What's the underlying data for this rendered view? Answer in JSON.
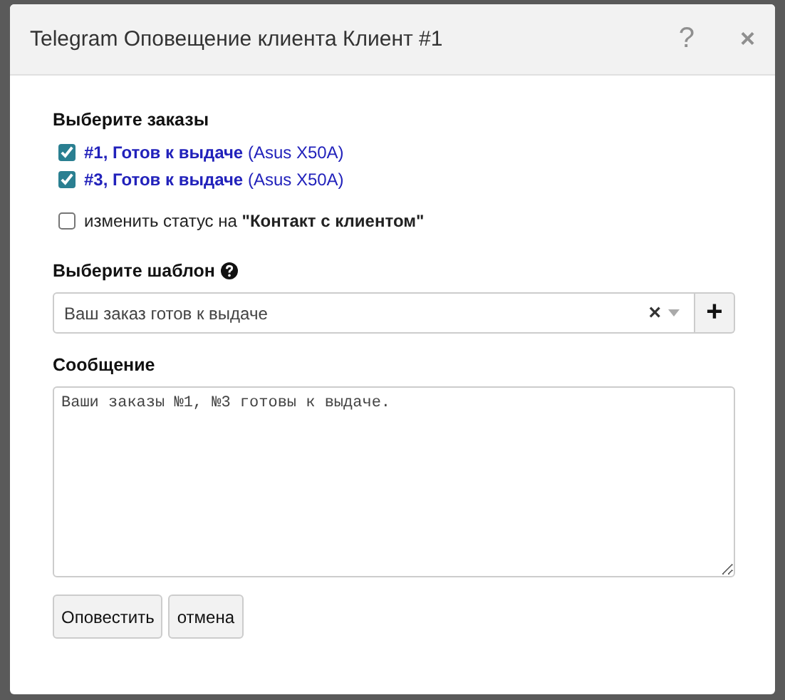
{
  "dialog": {
    "title": "Telegram Оповещение клиента Клиент #1",
    "help": "?",
    "close": "×"
  },
  "orders": {
    "label": "Выберите заказы",
    "items": [
      {
        "text": "**#1, Готов к выдаче** (Asus X50A)",
        "checked": true
      },
      {
        "text": "**#3, Готов к выдаче** (Asus X50A)",
        "checked": true
      }
    ]
  },
  "status_change": {
    "text": "изменить статус на **\"Контакт с клиентом\"**",
    "checked": false
  },
  "template": {
    "label": "Выберите шаблон",
    "value": "Ваш заказ готов к выдаче",
    "clear": "×",
    "add": "+"
  },
  "message": {
    "label": "Сообщение",
    "value": "Ваши заказы №1, №3 готовы к выдаче."
  },
  "buttons": [
    "Оповестить",
    "отмена"
  ]
}
